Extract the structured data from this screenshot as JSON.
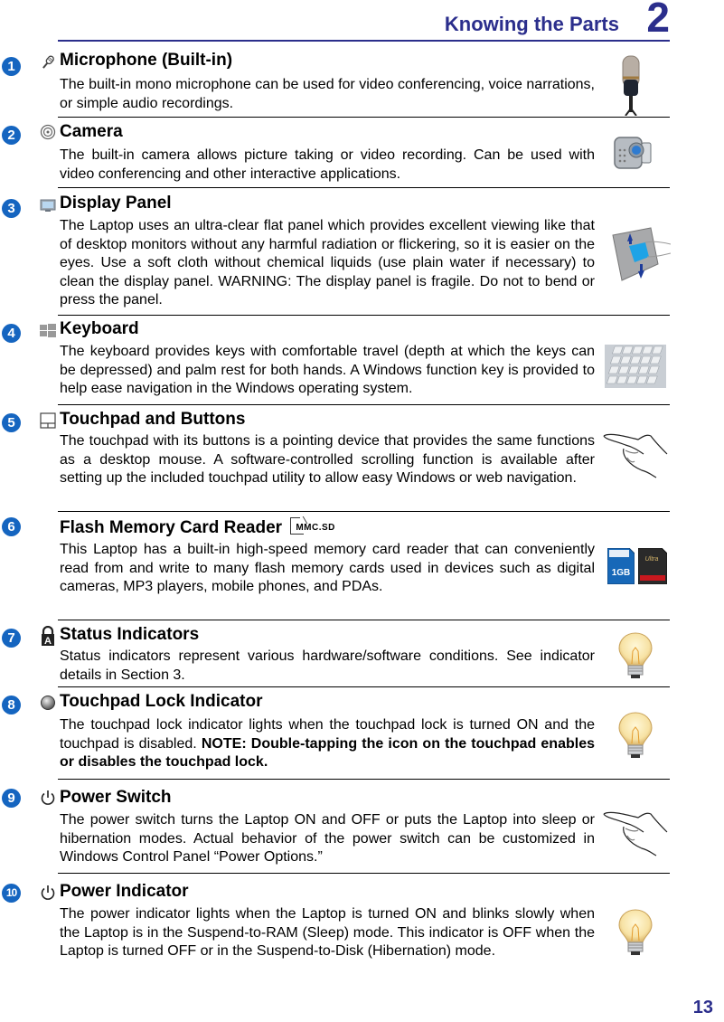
{
  "header": {
    "title": "Knowing the Parts",
    "chapter": "2"
  },
  "page_number": "13",
  "colors": {
    "accent": "#2b2e8c",
    "badge": "#1565c0"
  },
  "sections": [
    {
      "number": "1",
      "icon": "microphone-icon",
      "title": "Microphone (Built-in)",
      "body": "The built-in mono microphone can be used for video conferencing, voice narrations, or simple audio recordings.",
      "picture": "studio-microphone"
    },
    {
      "number": "2",
      "icon": "camera-icon",
      "title": "Camera",
      "body": "The built-in camera allows picture taking or video recording. Can be used with video conferencing and other interactive applications.",
      "picture": "video-camera"
    },
    {
      "number": "3",
      "icon": "monitor-icon",
      "title": "Display Panel",
      "body": "The Laptop uses an ultra-clear flat panel which provides excellent viewing like that of desktop monitors without any harmful radiation or flickering, so it is easier on the eyes. Use a soft cloth without chemical liquids (use plain water if necessary) to clean the display panel. WARNING: The display panel is fragile. Do not to bend or press the panel.",
      "picture": "hand-on-panel"
    },
    {
      "number": "4",
      "icon": "windows-icon",
      "title": "Keyboard",
      "body": "The keyboard provides keys with comfortable travel (depth at which the keys can be depressed) and palm rest for both hands. A Windows function key is provided to help ease navigation in the Windows operating system.",
      "picture": "keyboard"
    },
    {
      "number": "5",
      "icon": "touchpad-icon",
      "title": "Touchpad and Buttons",
      "body": "The touchpad with its buttons is a pointing device that provides the same functions as a desktop mouse. A software-controlled scrolling function is available after setting up the included touchpad utility to allow easy Windows or web navigation.",
      "picture": "finger-pointing"
    },
    {
      "number": "6",
      "icon": "memory-card-icon",
      "title": "Flash Memory Card Reader",
      "icon_label": "MMC.SD",
      "body": "This Laptop has a built-in high-speed memory card reader that can conveniently read from and write to many flash memory cards used in devices such as digital cameras, MP3 players, mobile phones, and PDAs.",
      "picture": "sd-cards",
      "card_labels": [
        "1GB",
        "Ultra"
      ]
    },
    {
      "number": "7",
      "icon": "lock-a-icon",
      "title": "Status Indicators",
      "body": "Status indicators represent various hardware/software conditions. See indicator details in Section 3.",
      "picture": "light-bulb"
    },
    {
      "number": "8",
      "icon": "indicator-circle-icon",
      "title": "Touchpad Lock Indicator",
      "body": "The touchpad lock indicator lights when the touchpad lock is turned ON and the touchpad is disabled. ",
      "body_bold": "NOTE: Double-tapping the icon on the touchpad enables or disables the touchpad lock.",
      "picture": "light-bulb"
    },
    {
      "number": "9",
      "icon": "power-icon",
      "title": "Power Switch",
      "body": "The power switch turns the Laptop ON and OFF or puts the Laptop into sleep or hibernation modes. Actual behavior of the power switch can be customized in Windows Control Panel “Power Options.”",
      "picture": "finger-pointing"
    },
    {
      "number": "10",
      "icon": "power-icon",
      "title": "Power Indicator",
      "body": "The power indicator lights when the Laptop is turned ON and blinks slowly when the Laptop is in the Suspend-to-RAM (Sleep) mode. This indicator is OFF when the Laptop is turned OFF or in the Suspend-to-Disk (Hibernation) mode.",
      "picture": "light-bulb"
    }
  ]
}
